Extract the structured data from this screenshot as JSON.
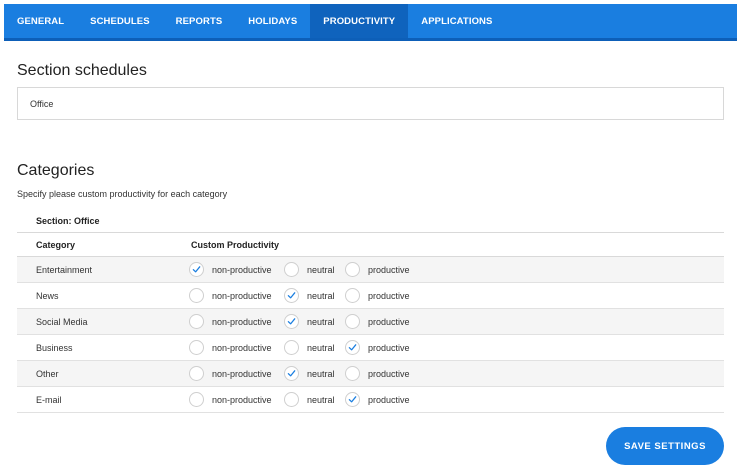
{
  "tabs": [
    {
      "label": "GENERAL"
    },
    {
      "label": "SCHEDULES"
    },
    {
      "label": "REPORTS"
    },
    {
      "label": "HOLIDAYS"
    },
    {
      "label": "PRODUCTIVITY",
      "active": true
    },
    {
      "label": "APPLICATIONS"
    }
  ],
  "section_schedules": {
    "title": "Section schedules",
    "selected": "Office"
  },
  "categories": {
    "title": "Categories",
    "description": "Specify please custom productivity for each category",
    "section_label": "Section: Office",
    "columns": {
      "category": "Category",
      "custom": "Custom Productivity"
    },
    "options": [
      "non-productive",
      "neutral",
      "productive"
    ],
    "rows": [
      {
        "name": "Entertainment",
        "selected": "non-productive"
      },
      {
        "name": "News",
        "selected": "neutral"
      },
      {
        "name": "Social Media",
        "selected": "neutral"
      },
      {
        "name": "Business",
        "selected": "productive"
      },
      {
        "name": "Other",
        "selected": "neutral"
      },
      {
        "name": "E-mail",
        "selected": "productive"
      }
    ]
  },
  "save_button": {
    "label": "SAVE SETTINGS"
  },
  "colors": {
    "accent": "#1a7ee0",
    "accent_dark": "#0f63bd",
    "check": "#1a7ee0"
  }
}
